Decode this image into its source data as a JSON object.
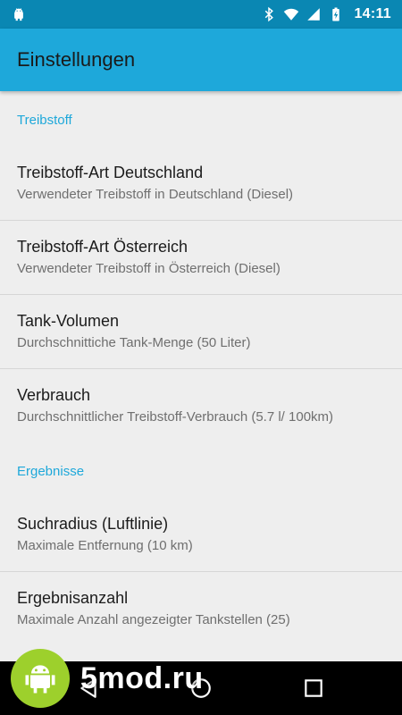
{
  "statusbar": {
    "time": "14:11",
    "icons": [
      "android-icon",
      "bluetooth-icon",
      "wifi-icon",
      "signal-icon",
      "battery-icon"
    ]
  },
  "toolbar": {
    "title": "Einstellungen"
  },
  "categories": {
    "fuel": {
      "title": "Treibstoff",
      "items": [
        {
          "title": "Treibstoff-Art Deutschland",
          "summary": "Verwendeter Treibstoff in Deutschland (Diesel)"
        },
        {
          "title": "Treibstoff-Art Österreich",
          "summary": "Verwendeter Treibstoff in Österreich (Diesel)"
        },
        {
          "title": "Tank-Volumen",
          "summary": "Durchschnittiche Tank-Menge (50 Liter)"
        },
        {
          "title": "Verbrauch",
          "summary": "Durchschnittlicher Treibstoff-Verbrauch (5.7 l/ 100km)"
        }
      ]
    },
    "results": {
      "title": "Ergebnisse",
      "items": [
        {
          "title": "Suchradius (Luftlinie)",
          "summary": "Maximale Entfernung (10 km)"
        },
        {
          "title": "Ergebnisanzahl",
          "summary": "Maximale Anzahl angezeigter Tankstellen (25)"
        }
      ]
    }
  },
  "navbar": {
    "buttons": [
      "back-icon",
      "home-icon",
      "recents-icon"
    ]
  },
  "watermark": {
    "text": "5mod.ru"
  },
  "colors": {
    "statusbar": "#0a87b3",
    "toolbar": "#1ea8da",
    "accent": "#1ea8da",
    "background": "#eeeeee",
    "watermark_logo": "#9dd02c"
  }
}
